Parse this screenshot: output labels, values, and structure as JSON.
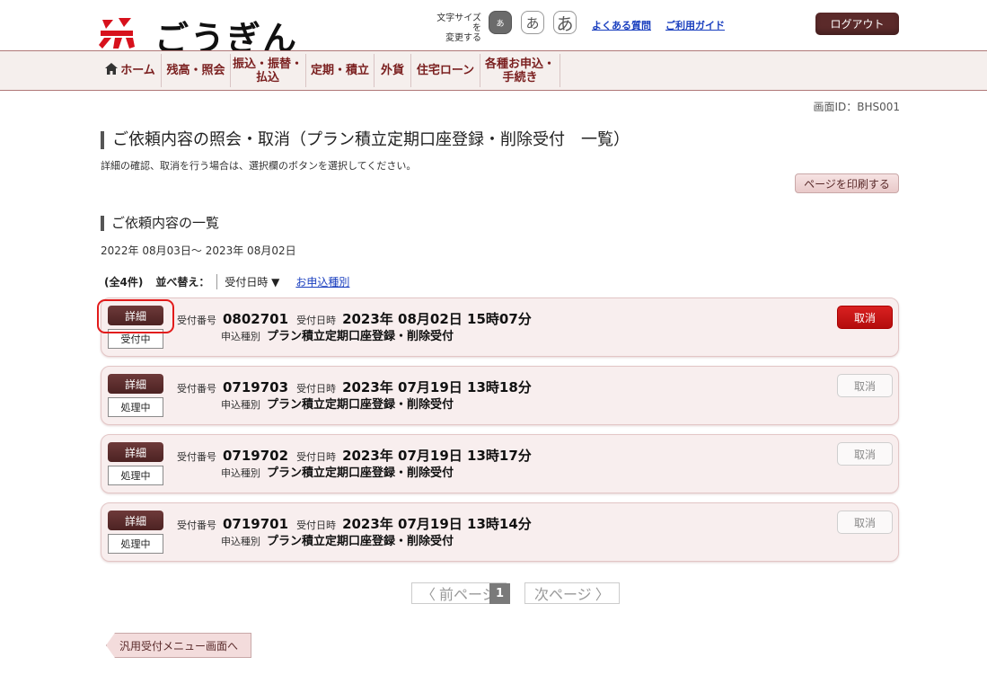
{
  "header": {
    "logo_text": "ごうぎん",
    "font_size_label_1": "文字サイズを",
    "font_size_label_2": "変更する",
    "font_small": "あ",
    "font_medium": "あ",
    "font_large": "あ",
    "faq_link": "よくある質問",
    "guide_link": "ご利用ガイド",
    "logout_label": "ログアウト"
  },
  "nav": {
    "home": "ホーム",
    "balance": "残高・照会",
    "transfer_1": "振込・振替・",
    "transfer_2": "払込",
    "deposit": "定期・積立",
    "forex": "外貨",
    "loan": "住宅ローン",
    "apply_1": "各種お申込・",
    "apply_2": "手続き"
  },
  "screen_id": "画面ID：BHS001",
  "page": {
    "title": "ご依頼内容の照会・取消（プラン積立定期口座登録・削除受付　一覧）",
    "description": "詳細の確認、取消を行う場合は、選択欄のボタンを選択してください。",
    "print_label": "ページを印刷する",
    "list_title": "ご依頼内容の一覧",
    "date_range": "2022年 08月03日～ 2023年 08月02日"
  },
  "sort": {
    "count": "(全4件)",
    "label": "並べ替え：",
    "selected": "受付日時 ▼",
    "alt_link": "お申込種別"
  },
  "labels": {
    "detail": "詳細",
    "receipt_no": "受付番号",
    "receipt_dt": "受付日時",
    "app_type": "申込種別",
    "cancel": "取消"
  },
  "requests": [
    {
      "status": "受付中",
      "receipt_no": "0802701",
      "receipt_dt": "2023年 08月02日 15時07分",
      "type": "プラン積立定期口座登録・削除受付",
      "cancel_active": true
    },
    {
      "status": "処理中",
      "receipt_no": "0719703",
      "receipt_dt": "2023年 07月19日 13時18分",
      "type": "プラン積立定期口座登録・削除受付",
      "cancel_active": false
    },
    {
      "status": "処理中",
      "receipt_no": "0719702",
      "receipt_dt": "2023年 07月19日 13時17分",
      "type": "プラン積立定期口座登録・削除受付",
      "cancel_active": false
    },
    {
      "status": "処理中",
      "receipt_no": "0719701",
      "receipt_dt": "2023年 07月19日 13時14分",
      "type": "プラン積立定期口座登録・削除受付",
      "cancel_active": false
    }
  ],
  "pagination": {
    "prev": "前ページ",
    "current": "1",
    "next": "次ページ"
  },
  "back_label": "汎用受付メニュー画面へ",
  "colors": {
    "brand": "#5b2a2a",
    "accent_red": "#c8102e",
    "card_bg": "#f8eeee"
  }
}
